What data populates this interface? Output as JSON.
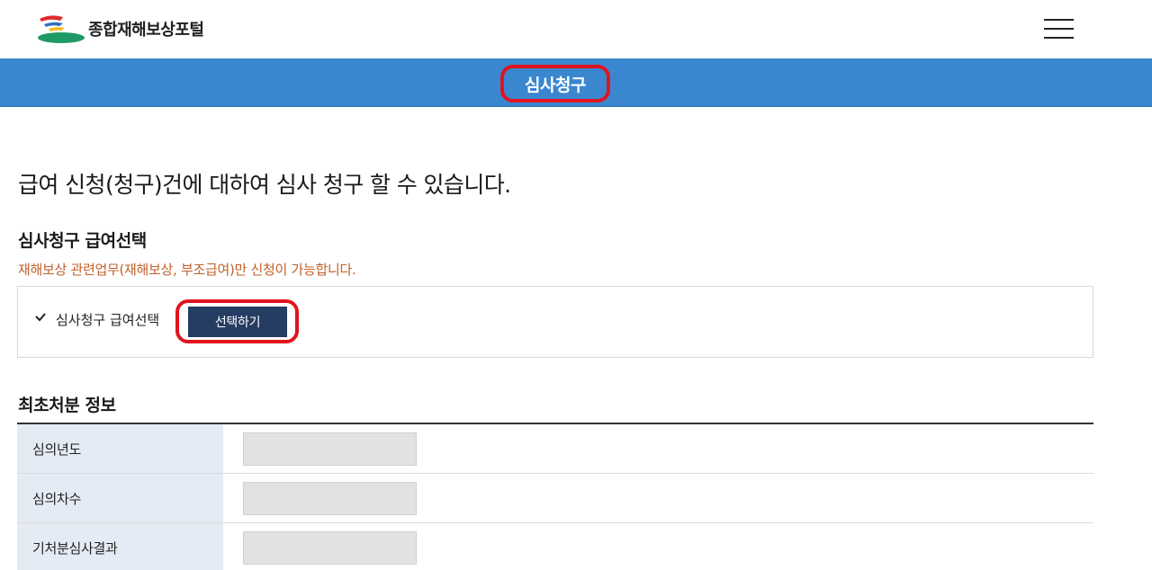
{
  "header": {
    "logo_text": "종합재해보상포털",
    "logo_icon": "kcomwel-logo-icon",
    "menu_icon": "hamburger-menu-icon"
  },
  "banner": {
    "title": "심사청구"
  },
  "main": {
    "headline": "급여 신청(청구)건에 대하여 심사 청구 할 수 있습니다.",
    "benefit_section": {
      "title": "심사청구 급여선택",
      "notice": "재해보상 관련업무(재해보상, 부조급여)만 신청이 가능합니다.",
      "field_label": "심사청구 급여선택",
      "select_button": "선택하기"
    },
    "initial_decision": {
      "title": "최초처분 정보",
      "rows": [
        {
          "label": "심의년도",
          "value": ""
        },
        {
          "label": "심의차수",
          "value": ""
        },
        {
          "label": "기처분심사결과",
          "value": ""
        }
      ]
    }
  },
  "colors": {
    "banner": "#3a87d0",
    "highlight": "#e0141e",
    "button": "#263d63",
    "notice": "#c2602a",
    "table_header": "#e4ebf4"
  }
}
